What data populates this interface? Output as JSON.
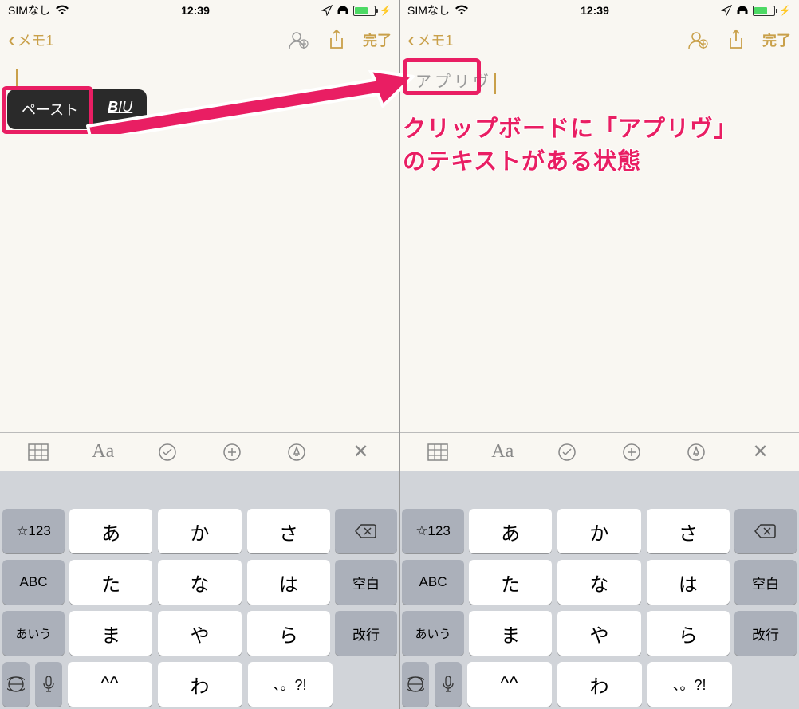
{
  "status": {
    "carrier": "SIMなし",
    "time": "12:39"
  },
  "nav": {
    "back_label": "メモ1",
    "done": "完了"
  },
  "left": {
    "menu": {
      "paste": "ペースト",
      "format": "BIU"
    }
  },
  "right": {
    "pasted_text": "アプリヴ"
  },
  "annotation": {
    "line1": "クリップボードに「アプリヴ」",
    "line2": "のテキストがある状態"
  },
  "toolbar": {
    "aa": "Aa"
  },
  "keyboard": {
    "mode123": "☆123",
    "abc": "ABC",
    "aiu": "あいう",
    "space": "空白",
    "enter": "改行",
    "rows": [
      [
        "あ",
        "か",
        "さ"
      ],
      [
        "た",
        "な",
        "は"
      ],
      [
        "ま",
        "や",
        "ら"
      ]
    ],
    "bottom": [
      "^^",
      "わ",
      "、。?!"
    ]
  }
}
